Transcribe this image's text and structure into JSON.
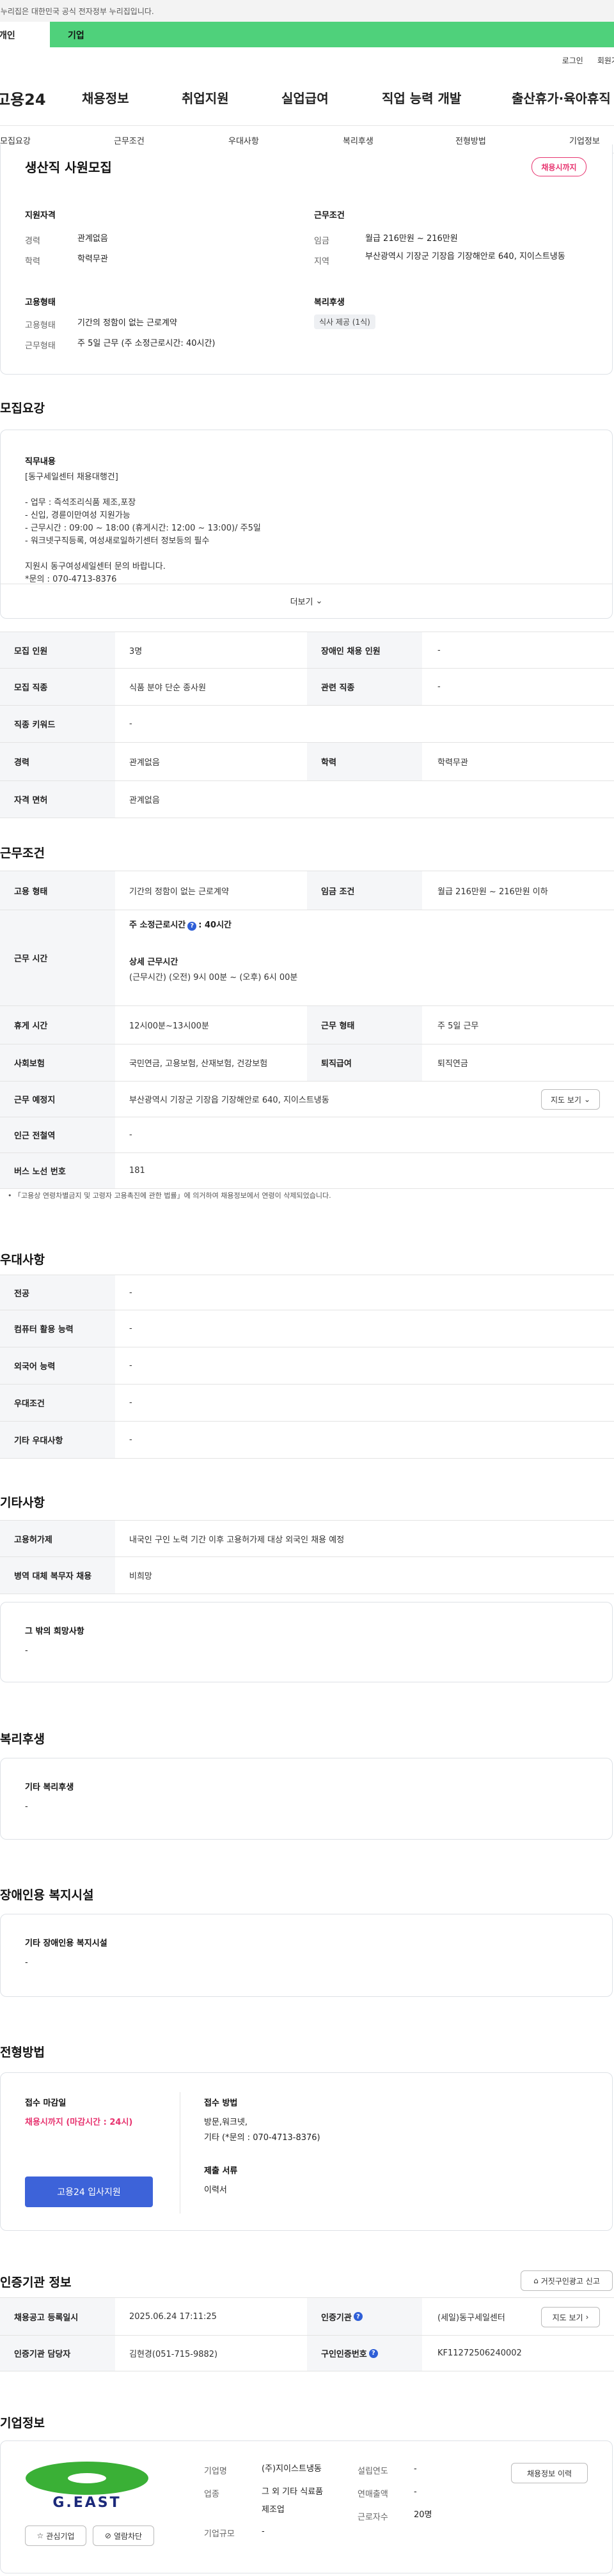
{
  "topbar": {
    "notice": "이 누리집은 대한민국 공식 전자정부 누리집입니다."
  },
  "user_tabs": {
    "personal": "개인",
    "company": "기업"
  },
  "util": {
    "login": "로그인",
    "signup": "회원가입"
  },
  "gnb": {
    "logo": "고용24",
    "items": [
      "채용정보",
      "취업지원",
      "실업급여",
      "직업 능력 개발",
      "출산휴가·육아휴직"
    ]
  },
  "subtabs": [
    "모집요강",
    "근무조건",
    "우대사항",
    "복리후생",
    "전형방법",
    "기업정보"
  ],
  "summary": {
    "title": "생산직 사원모집",
    "badge": "채용시까지",
    "qual_title": "지원자격",
    "career_lbl": "경력",
    "career_val": "관계없음",
    "edu_lbl": "학력",
    "edu_val": "학력무관",
    "cond_title": "근무조건",
    "wage_lbl": "임금",
    "wage_val": "월급 216만원 ~ 216만원",
    "region_lbl": "지역",
    "region_val": "부산광역시 기장군 기장읍 기장해안로 640, 지이스트냉동",
    "emp_title": "고용형태",
    "emp_lbl": "고용형태",
    "emp_val": "기간의 정함이 없는 근로계약",
    "work_lbl": "근무형태",
    "work_val": "주 5일 근무 (주 소정근로시간: 40시간)",
    "welfare_title": "복리후생",
    "welfare_pill": "식사 제공 (1식)"
  },
  "recruit": {
    "h": "모집요강",
    "duty_title": "직무내용",
    "duty_lines": [
      "[동구세일센터 채용대행건]",
      "",
      "- 업무 : 즉석조리식품 제조,포장",
      "- 신입, 경륜이만여성 지원가능",
      "- 근무시간 : 09:00 ~ 18:00 (휴게시간: 12:00 ~ 13:00)/ 주5일",
      "- 워크넷구직등록, 여성새로일하기센터 정보등의 필수",
      "",
      "지원시 동구여성세일센터 문의 바랍니다.",
      "*문의 : 070-4713-8376"
    ],
    "more": "더보기",
    "rows": [
      {
        "th1": "모집 인원",
        "td1": "3명",
        "th2": "장애인 채용 인원",
        "td2": "-"
      },
      {
        "th1": "모집 직종",
        "td1": "식품 분야 단순 종사원",
        "th2": "관련 직종",
        "td2": "-"
      },
      {
        "th1": "직종 키워드",
        "td1": "-"
      },
      {
        "th1": "경력",
        "td1": "관계없음",
        "th2": "학력",
        "td2": "학력무관"
      },
      {
        "th1": "자격 면허",
        "td1": "관계없음"
      }
    ]
  },
  "conditions": {
    "h": "근무조건",
    "emp_th": "고용 형태",
    "emp_td": "기간의 정함이 없는 근로계약",
    "wage_th": "임금 조건",
    "wage_td": "월급 216만원 ~ 216만원 이하",
    "hours_th": "근무 시간",
    "hours_weekly": "주 소정근로시간",
    "hours_weekly_val": ": 40시간",
    "hours_detail_title": "상세 근무시간",
    "hours_detail": "(근무시간) (오전) 9시 00분 ~ (오후) 6시 00분",
    "break_th": "휴게 시간",
    "break_td": "12시00분~13시00분",
    "shape_th": "근무 형태",
    "shape_td": "주 5일 근무",
    "ins_th": "사회보험",
    "ins_td": "국민연금, 고용보험, 산재보험, 건강보험",
    "ret_th": "퇴직급여",
    "ret_td": "퇴직연금",
    "place_th": "근무 예정지",
    "place_td": "부산광역시 기장군 기장읍 기장해안로 640, 지이스트냉동",
    "map_btn": "지도 보기",
    "subway_th": "인근 전철역",
    "subway_td": "-",
    "bus_th": "버스 노선 번호",
    "bus_td": "181",
    "note": "「고용상 연령차별금지 및 고령자 고용촉진에 관한 법률」에 의거하여 채용정보에서 연령이 삭제되었습니다."
  },
  "prefer": {
    "h": "우대사항",
    "rows": [
      {
        "th": "전공",
        "td": "-"
      },
      {
        "th": "컴퓨터 활용 능력",
        "td": "-"
      },
      {
        "th": "외국어 능력",
        "td": "-"
      },
      {
        "th": "우대조건",
        "td": "-"
      },
      {
        "th": "기타 우대사항",
        "td": "-"
      }
    ]
  },
  "etc": {
    "h": "기타사항",
    "rows": [
      {
        "th": "고용허가제",
        "td": "내국인 구인 노력 기간 이후 고용허가제 대상 외국인 채용 예정"
      },
      {
        "th": "병역 대체 복무자 채용",
        "td": "비희망"
      }
    ],
    "card_title": "그 밖의 희망사항",
    "card_val": "-"
  },
  "welfare": {
    "h": "복리후생",
    "card_title": "기타 복리후생",
    "card_val": "-"
  },
  "disabled": {
    "h": "장애인용 복지시설",
    "card_title": "기타 장애인용 복지시설",
    "card_val": "-"
  },
  "selection": {
    "h": "전형방법",
    "deadline_title": "접수 마감일",
    "deadline_val": "채용시까지 (마감시간 : 24시)",
    "apply_btn": "고용24 입사지원",
    "method_title": "접수 방법",
    "method_val1": "방문,워크넷,",
    "method_val2": "기타 (*문의 : 070-4713-8376)",
    "docs_title": "제출 서류",
    "docs_val": "이력서"
  },
  "cert": {
    "h": "인증기관 정보",
    "report_btn": "거짓구인광고 신고",
    "rows": [
      {
        "th1": "채용공고 등록일시",
        "td1": "2025.06.24 17:11:25",
        "th2": "인증기관",
        "td2": "(세일)동구세일센터",
        "btn": "지도 보기"
      },
      {
        "th1": "인증기관 담당자",
        "td1": "김현경(051-715-9882)",
        "th2": "구인인증번호",
        "td2": "KF11272506240002"
      }
    ]
  },
  "company": {
    "h": "기업정보",
    "logo_text": "G.EAST",
    "fav_btn": "관심기업",
    "block_btn": "열람차단",
    "name_lbl": "기업명",
    "name_val": "(주)지이스트냉동",
    "ind_lbl": "업종",
    "ind_val1": "그 외 기타 식료품",
    "ind_val2": "제조업",
    "size_lbl": "기업규모",
    "size_val": "-",
    "year_lbl": "설립연도",
    "year_val": "-",
    "sales_lbl": "연매출액",
    "sales_val": "-",
    "emp_lbl": "근로자수",
    "emp_val": "20명",
    "history_btn": "채용정보 이력"
  }
}
